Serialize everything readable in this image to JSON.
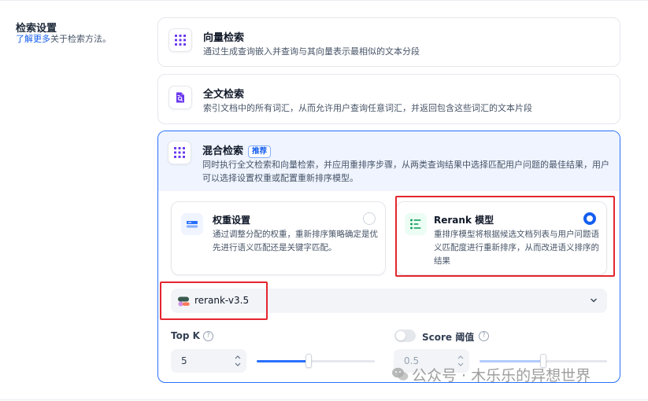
{
  "section": {
    "title": "检索设置",
    "link": "了解更多",
    "subtitle_rest": "关于检索方法。"
  },
  "methods": {
    "vector": {
      "title": "向量检索",
      "desc": "通过生成查询嵌入并查询与其向量表示最相似的文本分段",
      "icon": "vector-grid-icon"
    },
    "fulltext": {
      "title": "全文检索",
      "desc": "索引文档中的所有词汇，从而允许用户查询任意词汇，并返回包含这些词汇的文本片段",
      "icon": "document-search-icon"
    },
    "hybrid": {
      "title": "混合检索",
      "badge": "推荐",
      "desc": "同时执行全文检索和向量检索，并应用重排序步骤，从两类查询结果中选择匹配用户问题的最佳结果，用户可以选择设置权重或配置重新排序模型。",
      "icon": "hybrid-grid-icon"
    }
  },
  "options": {
    "weight": {
      "title": "权重设置",
      "desc": "通过调整分配的权重，重新排序策略确定是优先进行语义匹配还是关键字匹配。",
      "selected": false
    },
    "rerank": {
      "title": "Rerank 模型",
      "desc": "重排序模型将根据候选文档列表与用户问题语义匹配度进行重新排序，从而改进语义排序的结果",
      "selected": true
    }
  },
  "model_select": {
    "value": "rerank-v3.5"
  },
  "topk": {
    "label": "Top K",
    "value": "5",
    "slider_fraction": 0.44
  },
  "score": {
    "label": "Score 阈值",
    "value": "0.5",
    "enabled": false,
    "slider_fraction": 0.5
  },
  "watermark": "公众号 · 木乐乐的异想世界",
  "colors": {
    "accent": "#155eef",
    "highlight_box": "#e4262e"
  }
}
